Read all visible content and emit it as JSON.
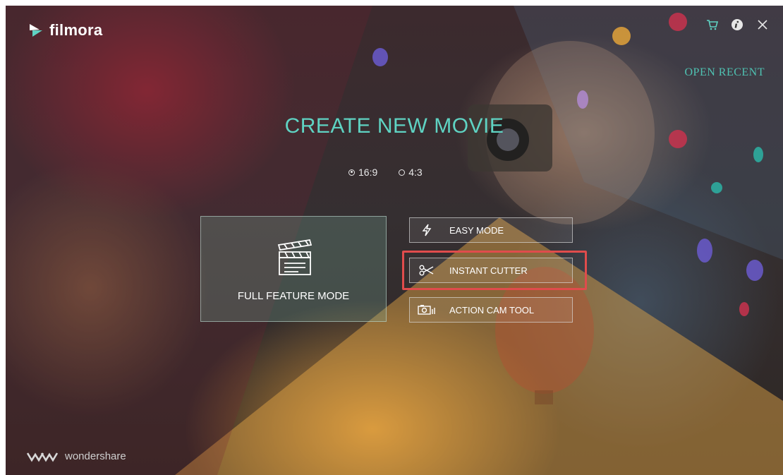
{
  "app": {
    "logo_text": "filmora",
    "vendor": "wondershare"
  },
  "top_bar": {
    "icons": [
      "cart-icon",
      "info-icon",
      "close-icon"
    ]
  },
  "open_recent": "OPEN RECENT",
  "create": {
    "title": "CREATE NEW MOVIE",
    "ratios": [
      {
        "label": "16:9",
        "selected": true
      },
      {
        "label": "4:3",
        "selected": false
      }
    ]
  },
  "modes": {
    "full_feature": "FULL FEATURE MODE",
    "easy": "EASY MODE",
    "instant_cutter": "INSTANT CUTTER",
    "action_cam": "ACTION CAM TOOL"
  },
  "colors": {
    "accent": "#5fd3c3",
    "highlight": "#e04c4c"
  }
}
